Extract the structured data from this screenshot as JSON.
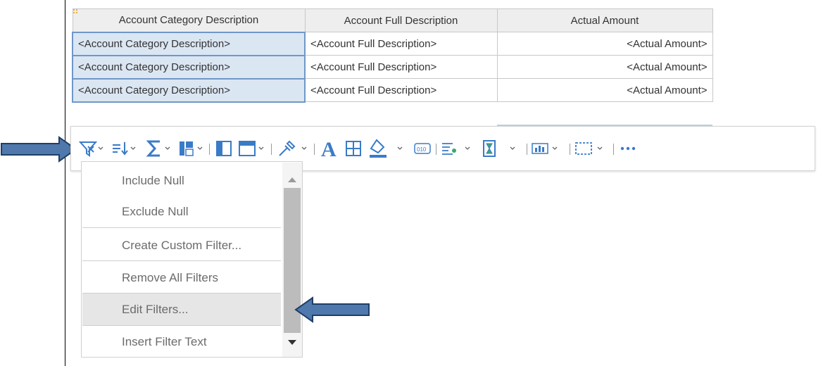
{
  "table": {
    "headers": [
      "Account Category Description",
      "Account Full Description",
      "Actual Amount"
    ],
    "rows": [
      [
        "<Account Category Description>",
        "<Account Full Description>",
        "<Actual Amount>"
      ],
      [
        "<Account Category Description>",
        "<Account Full Description>",
        "<Actual Amount>"
      ],
      [
        "<Account Category Description>",
        "<Account Full Description>",
        "<Actual Amount>"
      ]
    ]
  },
  "toolbar": {
    "buttons": [
      "filter-icon",
      "sort-icon",
      "summarize-icon",
      "pivot-icon",
      "hide-column-icon",
      "header-icon",
      "eyedropper-icon",
      "font-icon",
      "borders-icon",
      "fill-color-icon",
      "data-format-icon",
      "conditional-style-icon",
      "hourglass-icon",
      "visualization-icon",
      "selection-icon",
      "more-icon"
    ]
  },
  "filter_menu": {
    "items": [
      "Include Null",
      "Exclude Null",
      "Create Custom Filter...",
      "Remove All Filters",
      "Edit Filters...",
      "Insert Filter Text"
    ],
    "highlighted": "Edit Filters..."
  },
  "colors": {
    "selection_border": "#6f97c8",
    "selection_fill": "#dbe6f3",
    "arrow_fill": "#4f78ad",
    "arrow_border": "#1f3f67"
  }
}
